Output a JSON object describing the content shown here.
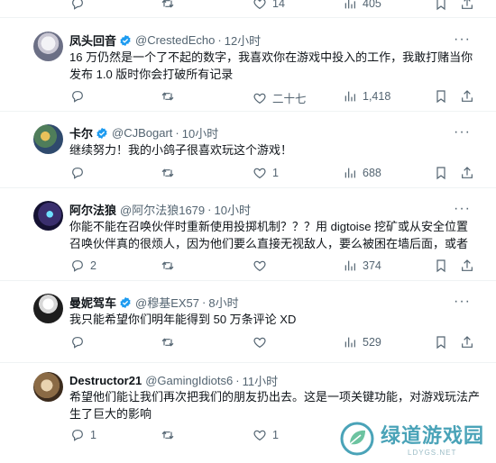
{
  "top_actions": {
    "reply": "",
    "retweet": "",
    "like": "14",
    "views": "405"
  },
  "tweets": [
    {
      "name": "凤头回音",
      "verified": true,
      "handle": "@CrestedEcho",
      "time": "12小时",
      "text": "16 万仍然是一个了不起的数字，我喜欢你在游戏中投入的工作，我敢打赌当你发布 1.0 版时你会打破所有记录",
      "reply": "",
      "retweet": "",
      "like": "二十七",
      "views": "1,418"
    },
    {
      "name": "卡尔",
      "verified": true,
      "handle": "@CJBogart",
      "time": "10小时",
      "text": "继续努力！我的小鸽子很喜欢玩这个游戏！",
      "reply": "",
      "retweet": "",
      "like": "1",
      "views": "688"
    },
    {
      "name": "阿尔法狼",
      "verified": false,
      "handle": "@阿尔法狼1679",
      "time": "10小时",
      "text": "你能不能在召唤伙伴时重新使用投掷机制？？？用 digtoise 挖矿或从安全位置召唤伙伴真的很烦人，因为他们要么直接无视敌人，要么被困在墙后面，或者",
      "reply": "2",
      "retweet": "",
      "like": "",
      "views": "374"
    },
    {
      "name": "曼妮驾车",
      "verified": true,
      "handle": "@穆基EX57",
      "time": "8小时",
      "text": "我只能希望你们明年能得到 50 万条评论 XD",
      "reply": "",
      "retweet": "",
      "like": "",
      "views": "529"
    },
    {
      "name": "Destructor21",
      "verified": false,
      "handle": "@GamingIdiots6",
      "time": "11小时",
      "text": "希望他们能让我们再次把我们的朋友扔出去。这是一项关键功能，对游戏玩法产生了巨大的影响",
      "reply": "1",
      "retweet": "",
      "like": "1",
      "views": ""
    }
  ],
  "more_icon": "···",
  "watermark": {
    "main": "绿道游戏园",
    "sub": "LDYGS.NET"
  },
  "colors": {
    "verified": "#1d9bf0",
    "muted": "#536471",
    "text": "#0f1419",
    "divider": "#eff3f4"
  }
}
